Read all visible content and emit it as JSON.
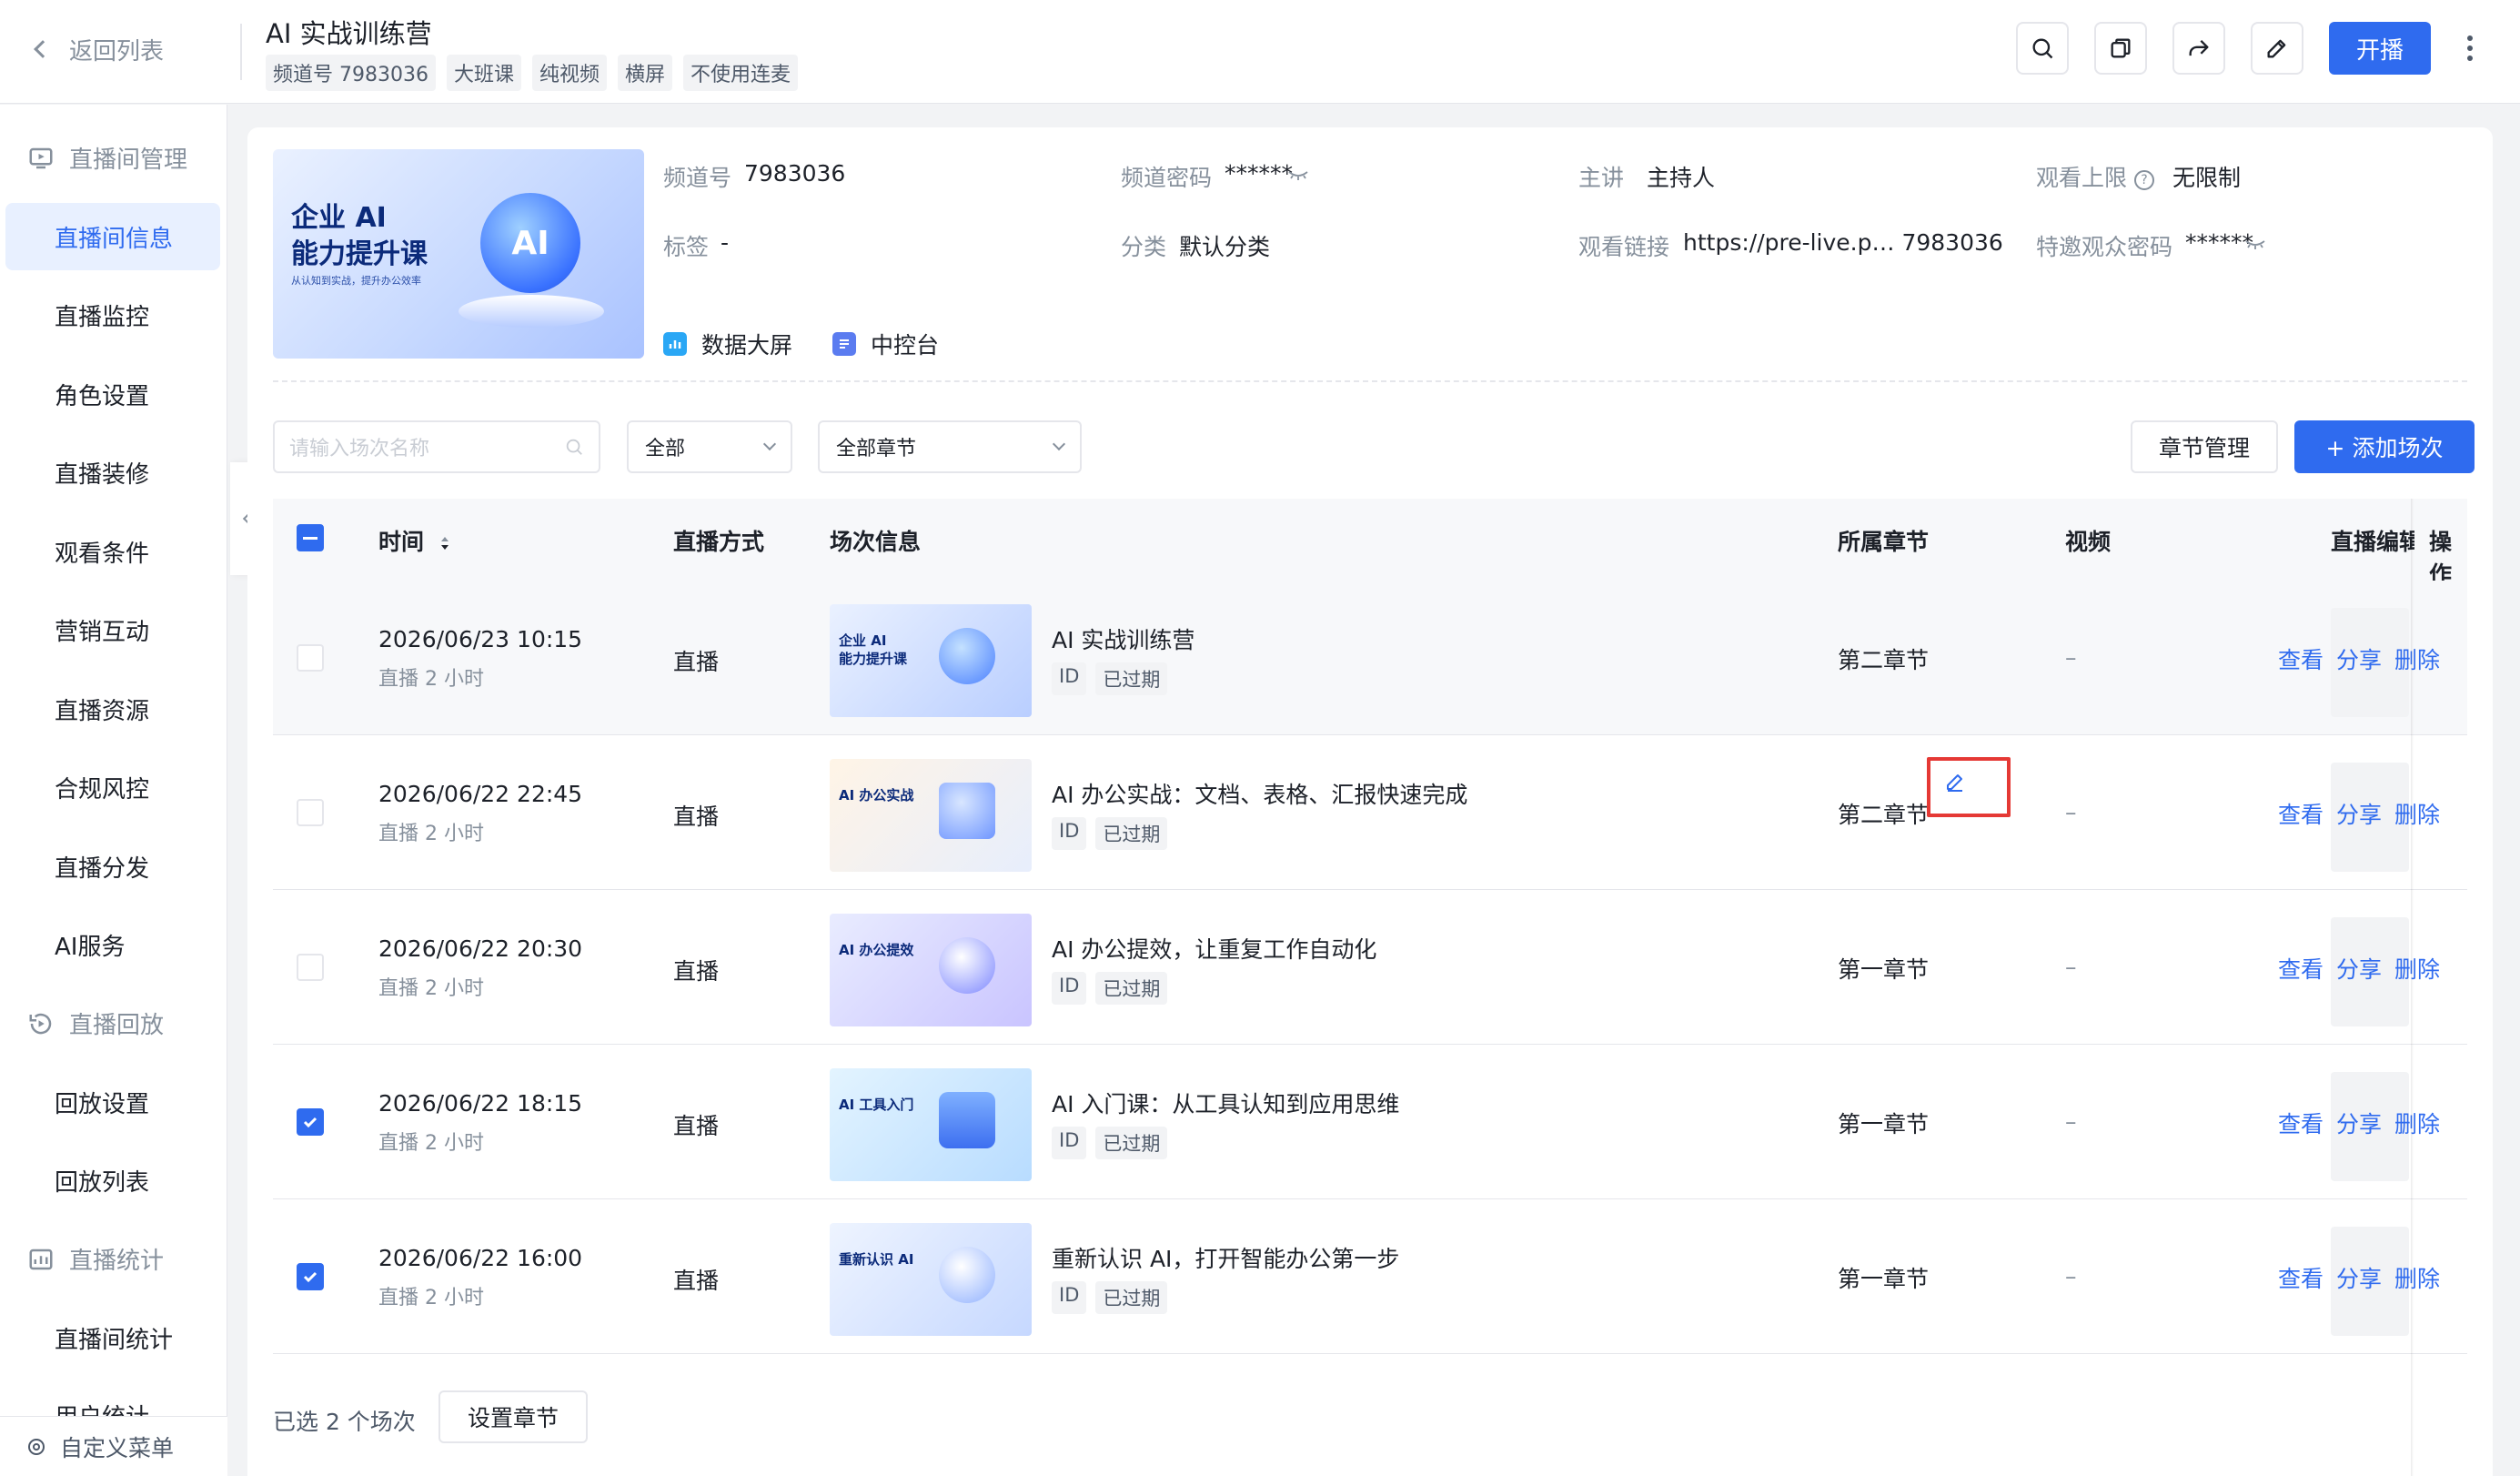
{
  "header": {
    "back_label": "返回列表",
    "title": "AI 实战训练营",
    "tags": [
      "频道号 7983036",
      "大班课",
      "纯视频",
      "横屏",
      "不使用连麦"
    ],
    "icons": [
      "search-icon",
      "copy-icon",
      "share-icon",
      "edit-icon",
      "more-icon"
    ],
    "start_label": "开播"
  },
  "sidebar": {
    "group_live": "直播间管理",
    "items_live": [
      "直播间信息",
      "直播监控",
      "角色设置",
      "直播装修",
      "观看条件",
      "营销互动",
      "直播资源",
      "合规风控",
      "直播分发",
      "AI服务"
    ],
    "group_replay": "直播回放",
    "items_replay": [
      "回放设置",
      "回放列表"
    ],
    "group_stats": "直播统计",
    "items_stats": [
      "直播间统计",
      "用户统计"
    ],
    "footer": "自定义菜单",
    "active": "直播间信息"
  },
  "info": {
    "cover": {
      "line1": "企业 AI",
      "line2": "能力提升课",
      "sub": "从认知到实战，提升办公效率",
      "orb": "AI"
    },
    "channel_label": "频道号",
    "channel_value": "7983036",
    "password_label": "频道密码",
    "password_value": "******",
    "speaker_label": "主讲",
    "speaker_value": "主持人",
    "limit_label": "观看上限",
    "limit_value": "无限制",
    "tag_label": "标签",
    "tag_value": "-",
    "category_label": "分类",
    "category_value": "默认分类",
    "link_label": "观看链接",
    "link_value": "https://pre-live.p… 7983036",
    "invite_label": "特邀观众密码",
    "invite_value": "******",
    "quick_dashboard": "数据大屏",
    "quick_console": "中控台"
  },
  "filters": {
    "search_placeholder": "请输入场次名称",
    "status_select": "全部",
    "chapter_select": "全部章节",
    "chapter_manage": "章节管理",
    "add_session": "+ 添加场次"
  },
  "table": {
    "headers": {
      "time": "时间",
      "mode": "直播方式",
      "info": "场次信息",
      "chapter": "所属章节",
      "video": "视频",
      "editor": "直播编辑",
      "ops": "操作"
    },
    "rows": [
      {
        "time": "2026/06/23 10:15",
        "duration": "直播 2 小时",
        "mode": "直播",
        "thumb_title": "企业 AI\n能力提升课",
        "title": "AI 实战训练营",
        "tags": [
          "ID",
          "已过期"
        ],
        "chapter": "第二章节",
        "video": "–",
        "checked": false,
        "ops": [
          "查看",
          "分享",
          "删除"
        ]
      },
      {
        "time": "2026/06/22 22:45",
        "duration": "直播 2 小时",
        "mode": "直播",
        "thumb_title": "AI 办公实战",
        "title": "AI 办公实战：文档、表格、汇报快速完成",
        "tags": [
          "ID",
          "已过期"
        ],
        "chapter": "第二章节",
        "video": "–",
        "checked": false,
        "ops": [
          "查看",
          "分享",
          "删除"
        ]
      },
      {
        "time": "2026/06/22 20:30",
        "duration": "直播 2 小时",
        "mode": "直播",
        "thumb_title": "AI 办公提效",
        "title": "AI 办公提效，让重复工作自动化",
        "tags": [
          "ID",
          "已过期"
        ],
        "chapter": "第一章节",
        "video": "–",
        "checked": false,
        "ops": [
          "查看",
          "分享",
          "删除"
        ]
      },
      {
        "time": "2026/06/22 18:15",
        "duration": "直播 2 小时",
        "mode": "直播",
        "thumb_title": "AI 工具入门",
        "title": "AI 入门课：从工具认知到应用思维",
        "tags": [
          "ID",
          "已过期"
        ],
        "chapter": "第一章节",
        "video": "–",
        "checked": true,
        "ops": [
          "查看",
          "分享",
          "删除"
        ]
      },
      {
        "time": "2026/06/22 16:00",
        "duration": "直播 2 小时",
        "mode": "直播",
        "thumb_title": "重新认识 AI",
        "title": "重新认识 AI，打开智能办公第一步",
        "tags": [
          "ID",
          "已过期"
        ],
        "chapter": "第一章节",
        "video": "–",
        "checked": true,
        "ops": [
          "查看",
          "分享",
          "删除"
        ]
      }
    ]
  },
  "footer": {
    "selected_text": "已选 2 个场次",
    "set_chapter": "设置章节"
  },
  "colors": {
    "primary": "#2f6bef",
    "highlight_box": "#e53935"
  }
}
